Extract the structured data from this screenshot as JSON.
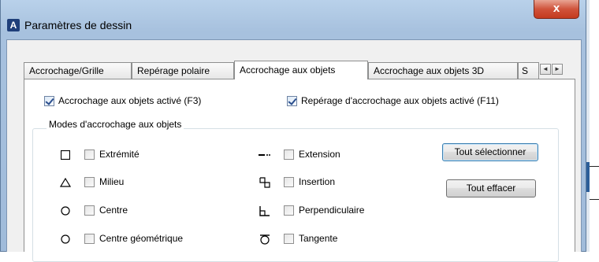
{
  "window": {
    "title": "Paramètres de dessin",
    "close_glyph": "x",
    "app_icon_letter": "A"
  },
  "tabs": [
    {
      "label": "Accrochage/Grille",
      "active": false
    },
    {
      "label": "Repérage polaire",
      "active": false
    },
    {
      "label": "Accrochage aux objets",
      "active": true
    },
    {
      "label": "Accrochage aux objets 3D",
      "active": false
    },
    {
      "label": "S",
      "active": false
    }
  ],
  "tab_scroll": {
    "left_glyph": "◄",
    "right_glyph": "►"
  },
  "top_options": {
    "osnap_on": {
      "label": "Accrochage aux objets activé (F3)",
      "checked": true
    },
    "otrack_on": {
      "label": "Repérage d'accrochage aux objets activé (F11)",
      "checked": true
    }
  },
  "modes_group": {
    "title": "Modes d'accrochage aux objets",
    "left_modes": [
      {
        "label": "Extrémité",
        "symbol": "square-icon",
        "checked": false
      },
      {
        "label": "Milieu",
        "symbol": "triangle-icon",
        "checked": false
      },
      {
        "label": "Centre",
        "symbol": "circle-icon",
        "checked": false
      },
      {
        "label": "Centre géométrique",
        "symbol": "circle-icon",
        "checked": false
      }
    ],
    "right_modes": [
      {
        "label": "Extension",
        "symbol": "extension-icon",
        "checked": false
      },
      {
        "label": "Insertion",
        "symbol": "insertion-icon",
        "checked": false
      },
      {
        "label": "Perpendiculaire",
        "symbol": "perpendicular-icon",
        "checked": false
      },
      {
        "label": "Tangente",
        "symbol": "tangent-icon",
        "checked": false
      }
    ],
    "select_all_label": "Tout sélectionner",
    "clear_all_label": "Tout effacer"
  },
  "colors": {
    "title_bar": "#b9d1ea",
    "close_button": "#c9452b",
    "dialog_bg": "#f0f0f0",
    "panel_bg": "#ffffff",
    "checkmark": "#2b4f8e"
  }
}
